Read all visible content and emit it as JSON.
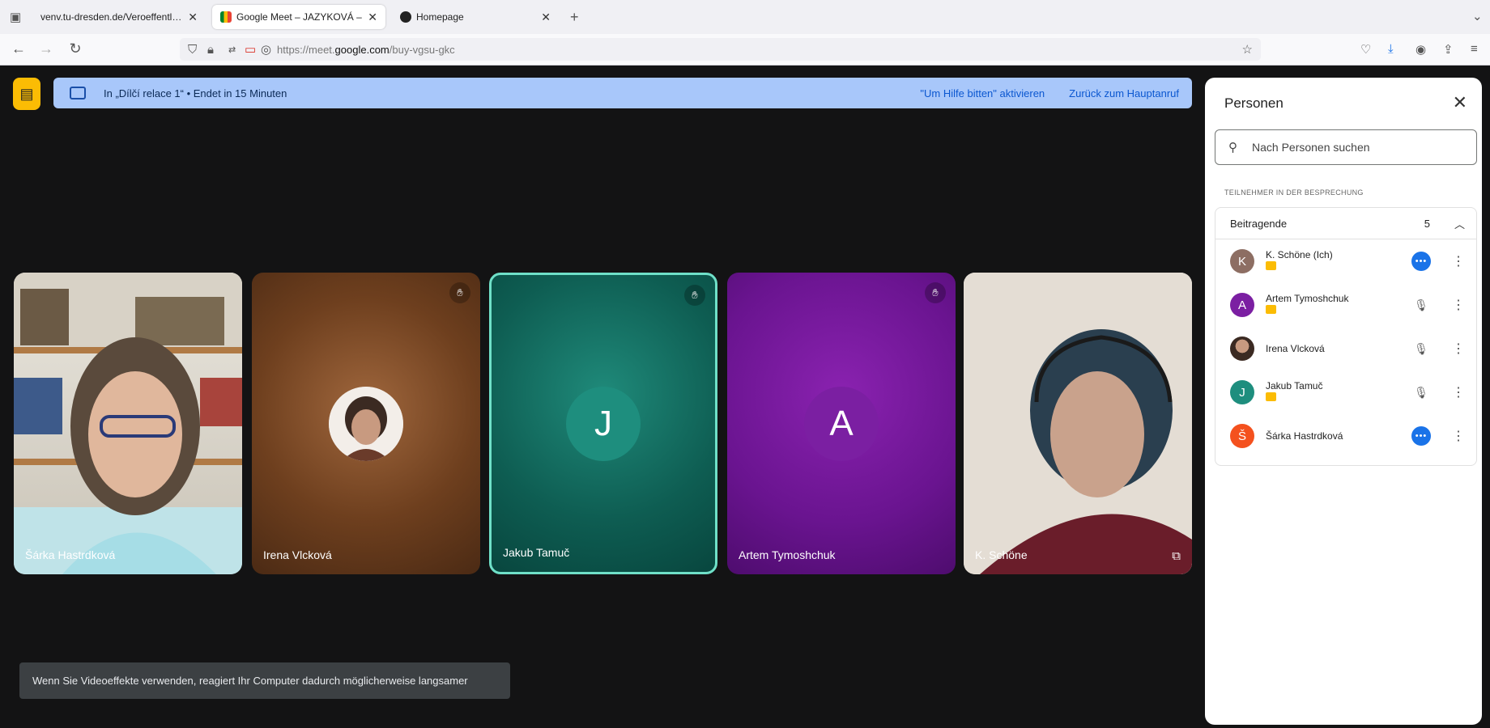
{
  "browser": {
    "tabs": [
      {
        "title": "venv.tu-dresden.de/Veroeffentlichungen/Form",
        "active": false
      },
      {
        "title": "Google Meet – JAZYKOVÁ – ",
        "active": true
      },
      {
        "title": "Homepage",
        "active": false
      }
    ],
    "url_prefix": "https://meet.",
    "url_domain": "google.com",
    "url_path": "/buy-vgsu-gkc"
  },
  "banner": {
    "text": "In „Dílčí relace 1“  •  Endet in 15 Minuten",
    "help_link": "\"Um Hilfe bitten\" aktivieren",
    "return_link": "Zurück zum Hauptanruf"
  },
  "tiles": [
    {
      "name": "Šárka Hastrdková",
      "type": "video"
    },
    {
      "name": "Irena Vlcková",
      "type": "photo"
    },
    {
      "name": "Jakub Tamuč",
      "type": "initial",
      "initial": "J",
      "color": "#1e8e7e"
    },
    {
      "name": "Artem Tymoshchuk",
      "type": "initial",
      "initial": "A",
      "color": "#7b1fa2"
    },
    {
      "name": "K. Schöne",
      "type": "video"
    }
  ],
  "toast": "Wenn Sie Videoeffekte verwenden, reagiert Ihr Computer dadurch möglicherweise langsamer",
  "panel": {
    "title": "Personen",
    "search_placeholder": "Nach Personen suchen",
    "section": "TEILNEHMER IN DER BESPRECHUNG",
    "group_label": "Beitragende",
    "group_count": "5",
    "people": [
      {
        "name": "K. Schöne (Ich)",
        "initial": "K",
        "color": "#8d6e63",
        "tag": true,
        "status": "speaking"
      },
      {
        "name": "Artem Tymoshchuk",
        "initial": "A",
        "color": "#7b1fa2",
        "tag": true,
        "status": "muted"
      },
      {
        "name": "Irena Vlcková",
        "initial": "",
        "color": "#5d4037",
        "tag": false,
        "status": "muted"
      },
      {
        "name": "Jakub Tamuč",
        "initial": "J",
        "color": "#1e8e7e",
        "tag": true,
        "status": "muted"
      },
      {
        "name": "Šárka Hastrdková",
        "initial": "Š",
        "color": "#f4511e",
        "tag": false,
        "status": "speaking"
      }
    ]
  }
}
